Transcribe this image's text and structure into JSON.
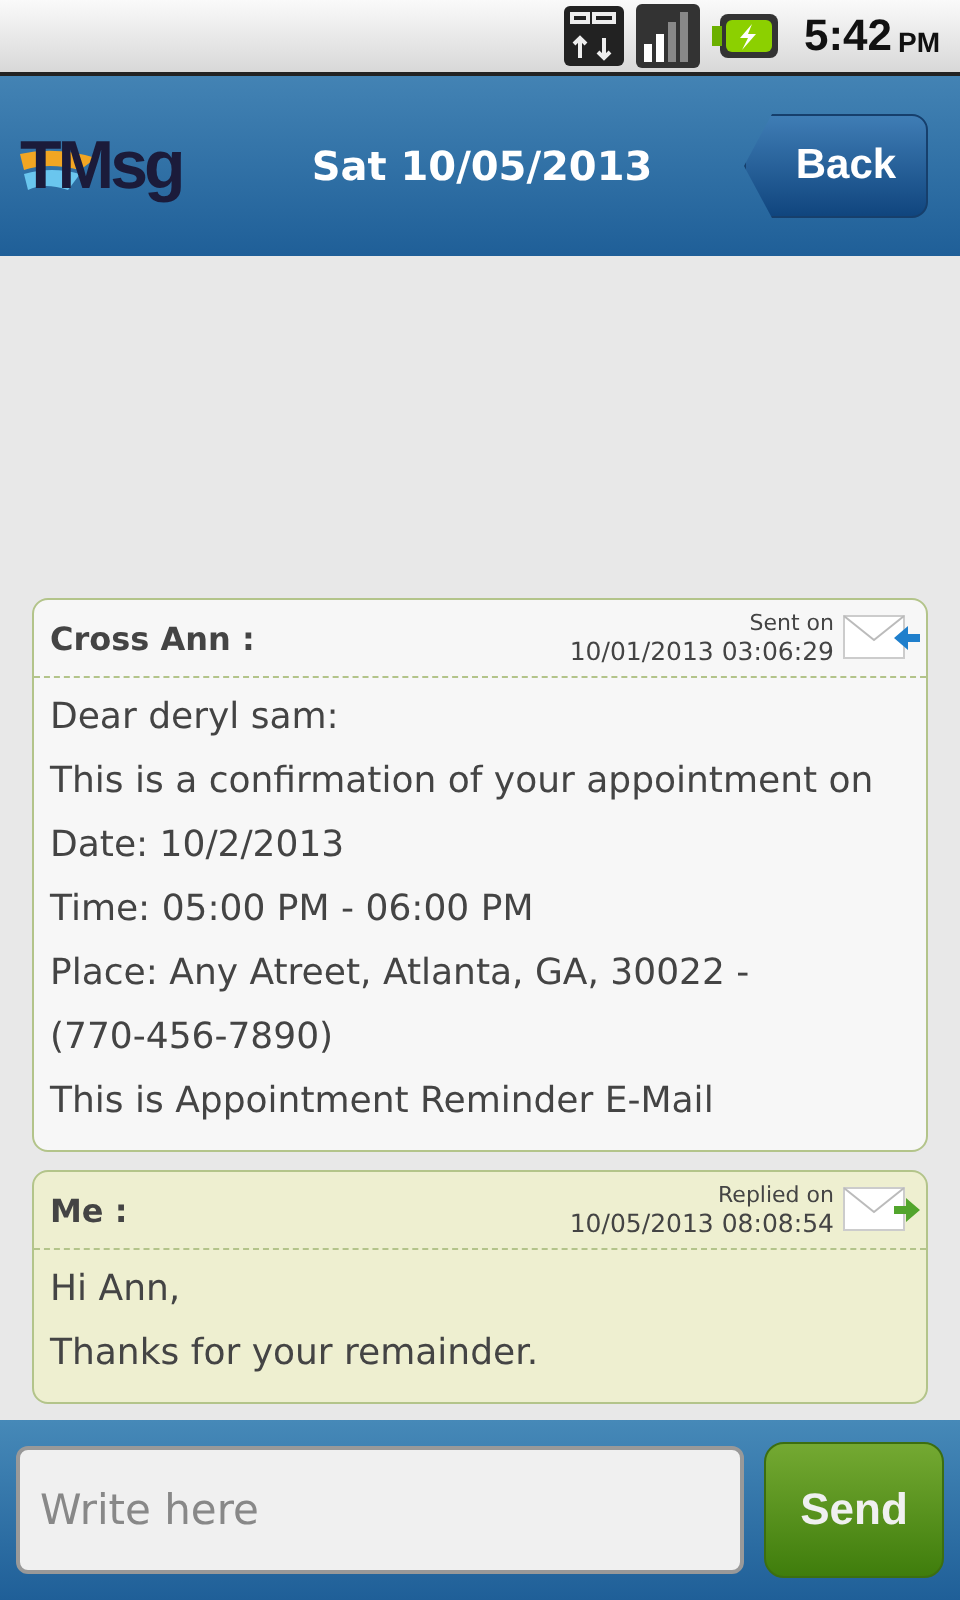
{
  "status_bar": {
    "time": "5:42",
    "period": "PM"
  },
  "header": {
    "logo": "TMsg",
    "title": "Sat 10/05/2013",
    "back_button": "Back"
  },
  "messages": [
    {
      "kind": "received",
      "sender": "Cross Ann :",
      "caption": "Sent on",
      "timestamp": "10/01/2013 03:06:29",
      "lines": [
        "Dear deryl sam:",
        "This is a confirmation of your appointment on",
        "Date: 10/2/2013",
        "Time: 05:00 PM - 06:00 PM",
        "Place: Any Atreet, Atlanta, GA, 30022 -",
        "(770-456-7890)",
        "This is Appointment Reminder E-Mail"
      ]
    },
    {
      "kind": "sent",
      "sender": "Me :",
      "caption": "Replied on",
      "timestamp": "10/05/2013 08:08:54",
      "lines": [
        "Hi Ann,",
        "Thanks for your remainder."
      ]
    }
  ],
  "composer": {
    "placeholder": "Write here",
    "send_button": "Send"
  }
}
